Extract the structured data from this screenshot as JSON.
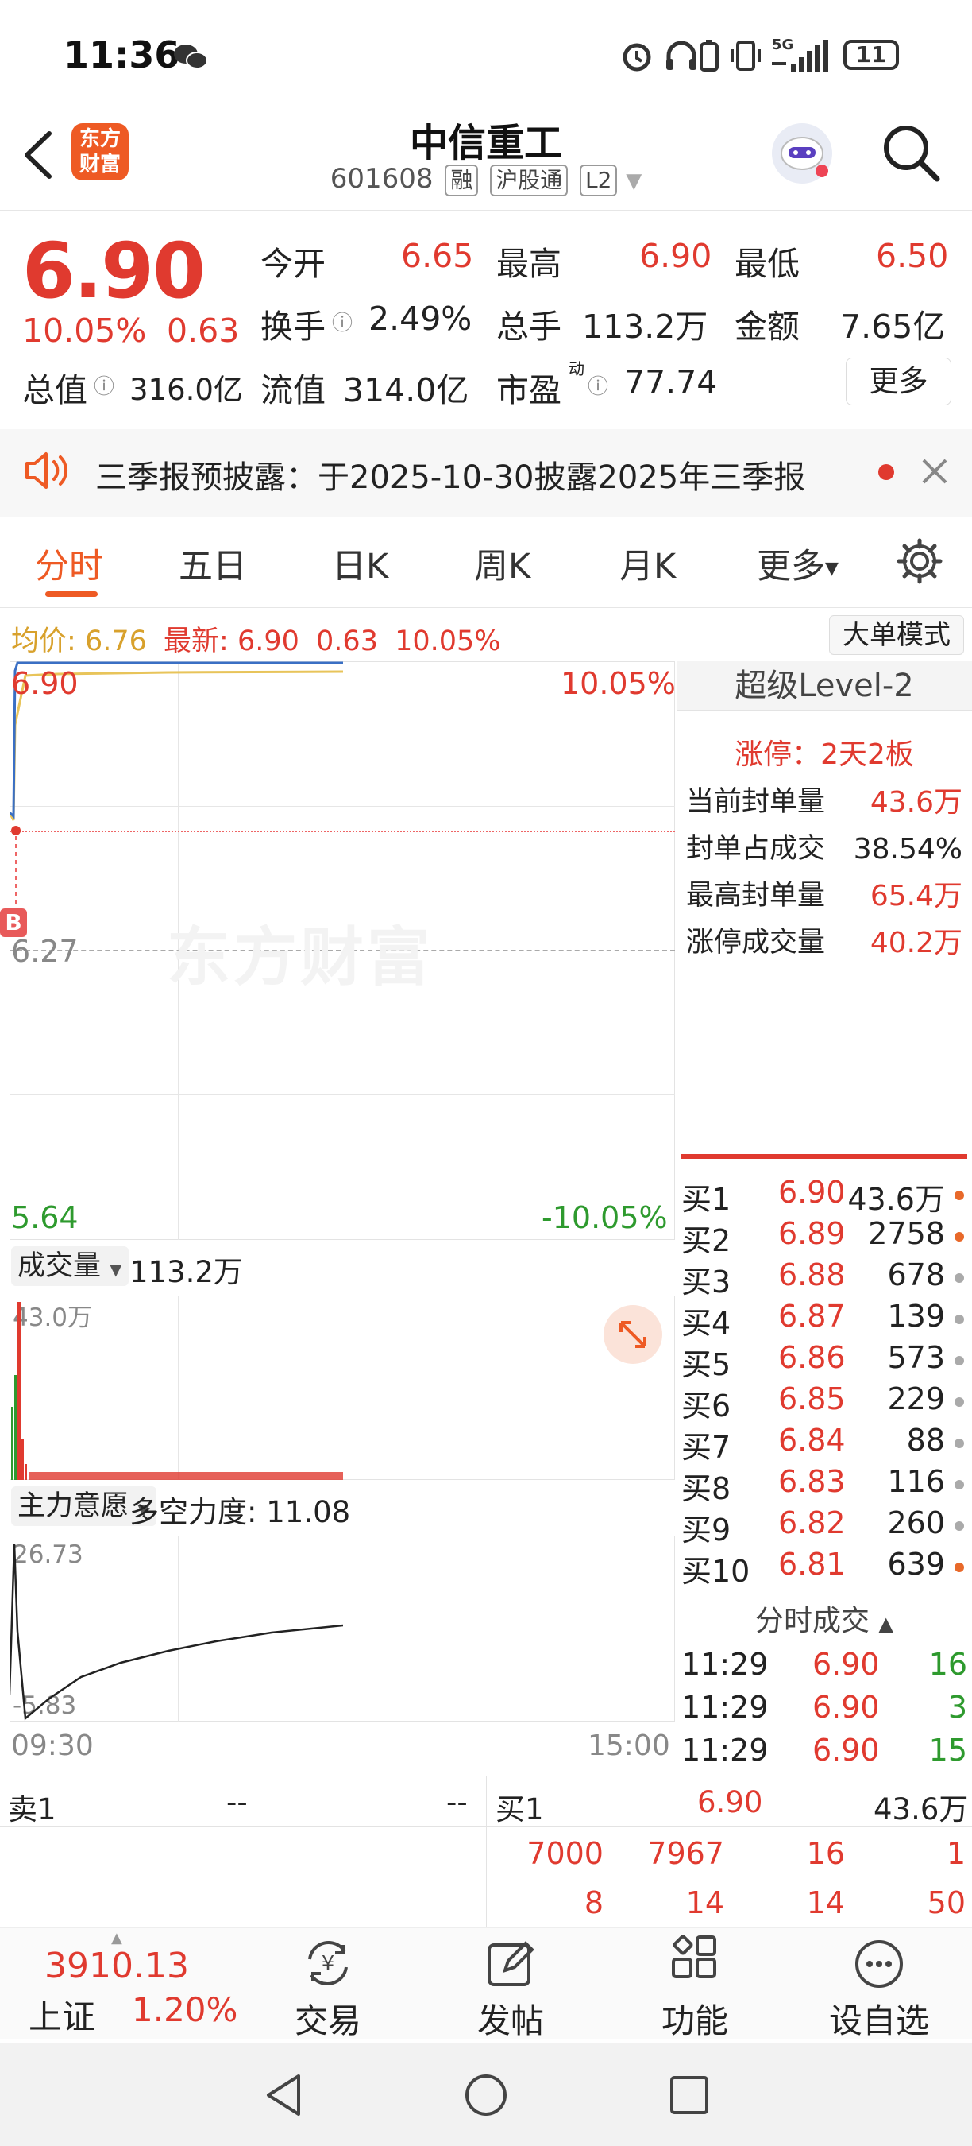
{
  "status_bar": {
    "time": "11:36",
    "battery": "11",
    "network": "5G"
  },
  "header": {
    "app_logo": "东方\n财富",
    "stock_name": "中信重工",
    "stock_code": "601608",
    "tags": [
      "融",
      "沪股通",
      "L2"
    ]
  },
  "quote": {
    "price": "6.90",
    "change_pct": "10.05%",
    "change": "0.63",
    "open_label": "今开",
    "open": "6.65",
    "high_label": "最高",
    "high": "6.90",
    "low_label": "最低",
    "low": "6.50",
    "turnover_label": "换手",
    "turnover": "2.49%",
    "volume_label": "总手",
    "volume": "113.2万",
    "amount_label": "金额",
    "amount": "7.65亿",
    "mktcap_label": "总值",
    "mktcap": "316.0亿",
    "float_label": "流值",
    "float": "314.0亿",
    "pe_label": "市盈",
    "pe_sup": "动",
    "pe": "77.74",
    "more_button": "更多"
  },
  "notice": {
    "text": "三季报预披露：于2025-10-30披露2025年三季报"
  },
  "tabs": [
    "分时",
    "五日",
    "日K",
    "周K",
    "月K",
    "更多"
  ],
  "info_line": {
    "avg_label": "均价:",
    "avg": "6.76",
    "latest_label": "最新:",
    "latest": "6.90",
    "chg": "0.63",
    "pct": "10.05%",
    "mode_button": "大单模式"
  },
  "chart": {
    "price_top": "6.90",
    "pct_top": "10.05%",
    "price_mid": "6.27",
    "price_bottom": "5.64",
    "pct_bottom": "-10.05%",
    "watermark": "东方财富",
    "b_marker": "B",
    "volume_selector": "成交量",
    "volume_total": "113.2万",
    "volume_max": "43.0万",
    "indicator_selector": "主力意愿",
    "indicator_label": "多空力度:",
    "indicator_value": "11.08",
    "ind_top": "26.73",
    "ind_bottom": "-5.83",
    "time_start": "09:30",
    "time_end": "15:00"
  },
  "level2": {
    "title": "超级Level-2",
    "limit": "涨停：2天2板",
    "rows": [
      {
        "label": "当前封单量",
        "value": "43.6万"
      },
      {
        "label": "封单占成交",
        "value": "38.54%"
      },
      {
        "label": "最高封单量",
        "value": "65.4万"
      },
      {
        "label": "涨停成交量",
        "value": "40.2万"
      }
    ]
  },
  "bids": [
    {
      "label": "买1",
      "price": "6.90",
      "vol": "43.6万",
      "dot": "#e8692a"
    },
    {
      "label": "买2",
      "price": "6.89",
      "vol": "2758",
      "dot": "#e8692a"
    },
    {
      "label": "买3",
      "price": "6.88",
      "vol": "678",
      "dot": "#aaaaaa"
    },
    {
      "label": "买4",
      "price": "6.87",
      "vol": "139",
      "dot": "#aaaaaa"
    },
    {
      "label": "买5",
      "price": "6.86",
      "vol": "573",
      "dot": "#aaaaaa"
    },
    {
      "label": "买6",
      "price": "6.85",
      "vol": "229",
      "dot": "#aaaaaa"
    },
    {
      "label": "买7",
      "price": "6.84",
      "vol": "88",
      "dot": "#aaaaaa"
    },
    {
      "label": "买8",
      "price": "6.83",
      "vol": "116",
      "dot": "#aaaaaa"
    },
    {
      "label": "买9",
      "price": "6.82",
      "vol": "260",
      "dot": "#aaaaaa"
    },
    {
      "label": "买10",
      "price": "6.81",
      "vol": "639",
      "dot": "#e8692a"
    }
  ],
  "ticks": {
    "title": "分时成交",
    "rows": [
      {
        "time": "11:29",
        "price": "6.90",
        "vol": "16"
      },
      {
        "time": "11:29",
        "price": "6.90",
        "vol": "3"
      },
      {
        "time": "11:29",
        "price": "6.90",
        "vol": "15"
      }
    ]
  },
  "queue": {
    "sell_label": "卖1",
    "sell_price": "--",
    "sell_vol": "--",
    "buy_label": "买1",
    "buy_price": "6.90",
    "buy_vol": "43.6万",
    "row1": [
      "7000",
      "7967",
      "16",
      "1"
    ],
    "row2": [
      "8",
      "14",
      "14",
      "50"
    ]
  },
  "nav": {
    "index_value": "3910.13",
    "index_name": "上证",
    "index_pct": "1.20%",
    "items": [
      {
        "label": "交易",
        "icon": "yen-exchange-icon"
      },
      {
        "label": "发帖",
        "icon": "edit-post-icon"
      },
      {
        "label": "功能",
        "icon": "grid-apps-icon"
      },
      {
        "label": "设自选",
        "icon": "more-dots-icon"
      }
    ]
  },
  "colors": {
    "up": "#e03a2f",
    "down": "#2e9a2e",
    "accent": "#ee5a24",
    "avg_line": "#e8c45a",
    "price_line": "#3a6fc4"
  }
}
